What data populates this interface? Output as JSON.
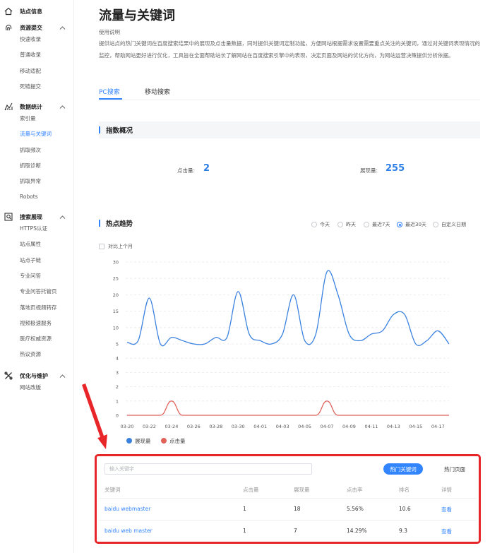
{
  "sidebar": {
    "sections": [
      {
        "title": "站点信息",
        "icon": "home-icon",
        "items": []
      },
      {
        "title": "资源提交",
        "icon": "fingerprint-icon",
        "items": [
          "快速收录",
          "普通收录",
          "移动适配",
          "死链提交"
        ]
      },
      {
        "title": "数据统计",
        "icon": "stats-icon",
        "items": [
          "索引量",
          "流量与关键词",
          "抓取频次",
          "抓取诊断",
          "抓取异常",
          "Robots"
        ]
      },
      {
        "title": "搜索展现",
        "icon": "search-display-icon",
        "items": [
          "HTTPS认证",
          "站点属性",
          "站点子链",
          "专业问答",
          "专业问答托管页",
          "落地页视频转存",
          "视频极速服务",
          "医疗权威资源",
          "热议资源"
        ]
      },
      {
        "title": "优化与维护",
        "icon": "tools-icon",
        "items": [
          "网站改版"
        ]
      }
    ],
    "active_item": "流量与关键词"
  },
  "main": {
    "title": "流量与关键词",
    "usage_title": "使用说明",
    "usage_desc": "提供站点的热门关键词在百度搜索结果中的展现及点击量数据，同时提供关键词定制功能，方便网站根据需求设置需要重点关注的关键词，通过对关键词表现情况的监控，帮助网站更好进行优化，工具旨在全面帮助站长了解网站在百度搜索引擎中的表现，决定页面及网站的优化方向，为网站运营决策提供分析依据。",
    "tabs": [
      {
        "label": "PC搜索",
        "active": true
      },
      {
        "label": "移动搜索",
        "active": false
      }
    ],
    "index_overview": {
      "title": "指数概况",
      "clicks_label": "点击量:",
      "clicks_value": "2",
      "impressions_label": "展现量:",
      "impressions_value": "255"
    },
    "trend": {
      "title": "热点趋势",
      "ranges": [
        {
          "label": "今天",
          "selected": false
        },
        {
          "label": "昨天",
          "selected": false
        },
        {
          "label": "最近7天",
          "selected": false
        },
        {
          "label": "最近30天",
          "selected": true
        },
        {
          "label": "自定义日期",
          "selected": false
        }
      ],
      "compare_label": "对比上个月"
    },
    "keywords": {
      "search_placeholder": "输入关键字",
      "hot_keywords_button": "热门关键词",
      "hot_pages_button": "热门页面",
      "columns": [
        "关键词",
        "点击量",
        "展现量",
        "点击率",
        "排名",
        "详情"
      ],
      "rows": [
        {
          "keyword": "baidu webmaster",
          "clicks": "1",
          "impressions": "18",
          "ctr": "5.56%",
          "rank": "10.6",
          "detail": "查看"
        },
        {
          "keyword": "baidu web master",
          "clicks": "1",
          "impressions": "7",
          "ctr": "14.29%",
          "rank": "9.3",
          "detail": "查看"
        }
      ]
    }
  },
  "colors": {
    "accent": "#3385ff",
    "impressions_series": "#3b82e0",
    "clicks_series": "#e0625b",
    "highlight_frame": "#e8262a"
  },
  "chart_data": {
    "type": "line",
    "x": [
      "03-20",
      "03-21",
      "03-22",
      "03-23",
      "03-24",
      "03-25",
      "03-26",
      "03-27",
      "03-28",
      "03-29",
      "03-30",
      "03-31",
      "04-01",
      "04-02",
      "04-03",
      "04-04",
      "04-05",
      "04-06",
      "04-07",
      "04-08",
      "04-09",
      "04-10",
      "04-11",
      "04-12",
      "04-13",
      "04-14",
      "04-15",
      "04-16",
      "04-17",
      "04-18"
    ],
    "tick_labels": [
      "03-20",
      "03-22",
      "03-24",
      "03-26",
      "03-28",
      "03-30",
      "04-01",
      "04-03",
      "04-05",
      "04-07",
      "04-09",
      "04-11",
      "04-13",
      "04-15",
      "04-17"
    ],
    "series": [
      {
        "name": "展现量",
        "values": [
          5.5,
          6,
          19,
          5,
          7,
          6,
          5,
          5,
          7,
          7,
          21,
          8,
          6,
          5,
          8,
          20,
          6,
          8,
          27,
          20,
          8,
          6,
          8,
          9,
          14,
          14,
          5,
          6,
          9,
          4.5
        ]
      },
      {
        "name": "点击量",
        "values": [
          0,
          0,
          0,
          0,
          1,
          0,
          0,
          0,
          0,
          0,
          0,
          0,
          0,
          0,
          0,
          0,
          0,
          0,
          1,
          0,
          0,
          0,
          0,
          0,
          0,
          0,
          0,
          0,
          0,
          0
        ]
      }
    ],
    "y_ticks_upper": [
      5,
      10,
      15,
      20,
      25,
      30
    ],
    "y_ticks_lower": [
      0,
      1,
      2,
      3,
      4,
      5
    ],
    "ylim_upper": [
      5,
      30
    ],
    "ylim_lower": [
      0,
      5
    ],
    "grid": true,
    "legend": "bottom-left"
  }
}
